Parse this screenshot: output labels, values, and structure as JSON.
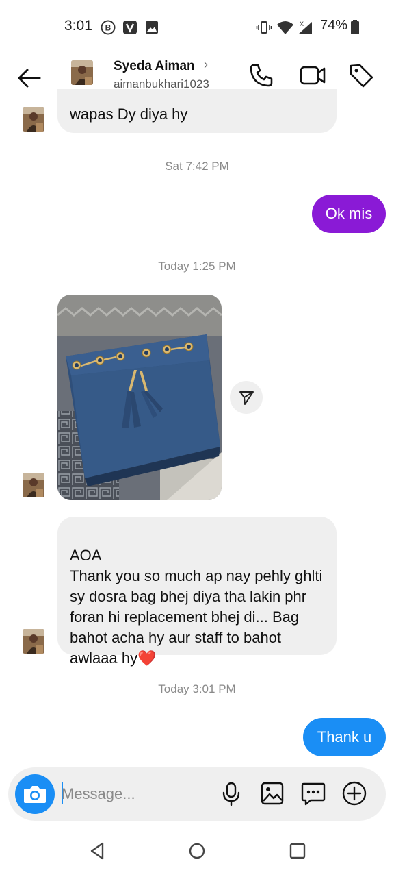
{
  "status_bar": {
    "time": "3:01",
    "battery": "74%",
    "icons": [
      "b-badge-icon",
      "v-app-icon",
      "gallery-notification-icon",
      "vibrate-icon",
      "wifi-icon",
      "signal-icon",
      "battery-icon"
    ]
  },
  "header": {
    "name": "Syeda Aiman",
    "chevron": "›",
    "username": "aimanbukhari1023",
    "icons": [
      "back-arrow-icon",
      "phone-icon",
      "video-camera-icon",
      "tag-icon"
    ]
  },
  "messages": {
    "partial_incoming": "wapas Dy diya hy",
    "timestamp_1": "Sat 7:42 PM",
    "outgoing_1": "Ok mis",
    "timestamp_2": "Today 1:25 PM",
    "incoming_long": "AOA\nThank you so much ap nay pehly ghlti sy dosra bag bhej diya tha lakin phr foran hi replacement bhej di... Bag bahot acha hy aur staff to bahot awlaaa hy❤️",
    "timestamp_3": "Today 3:01 PM",
    "outgoing_2": "Thank u"
  },
  "composer": {
    "placeholder": "Message...",
    "value": "",
    "icons": [
      "camera-icon",
      "microphone-icon",
      "image-icon",
      "sticker-chat-icon",
      "plus-circle-icon"
    ]
  },
  "colors": {
    "outgoing_purple": "#8a1ad6",
    "outgoing_blue": "#1a8ef5",
    "incoming_bg": "#efefef",
    "camera_button": "#1a8ef5"
  }
}
